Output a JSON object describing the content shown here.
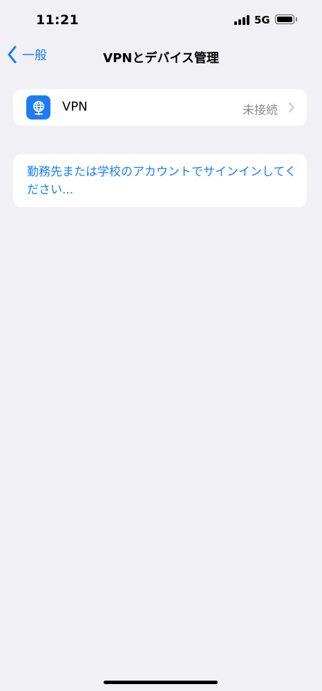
{
  "status_bar": {
    "time": "11:21",
    "network": "5G"
  },
  "nav": {
    "back_label": "一般",
    "title": "VPNとデバイス管理"
  },
  "vpn": {
    "label": "VPN",
    "status": "未接続",
    "icon": "globe-network-icon",
    "icon_color": "#1e7cf2"
  },
  "signin": {
    "text": "勤務先または学校のアカウントでサインインしてください..."
  },
  "colors": {
    "accent": "#157efb",
    "background": "#f0f0f5",
    "secondary_text": "#8a8a8e"
  }
}
